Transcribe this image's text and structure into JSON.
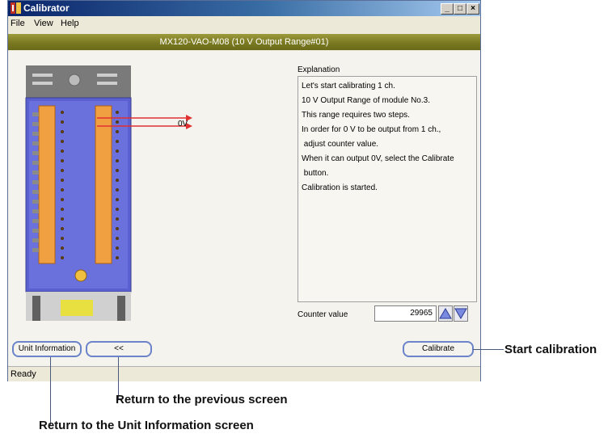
{
  "window": {
    "title": "Calibrator"
  },
  "menu": {
    "items": [
      "File",
      "View",
      "Help"
    ]
  },
  "header": {
    "title": "MX120-VAO-M08 (10 V Output Range#01)"
  },
  "diagram": {
    "output_label": "0V"
  },
  "explanation": {
    "label": "Explanation",
    "lines": [
      "Let's start calibrating 1 ch.",
      "10 V Output Range of module No.3.",
      "This range requires two steps.",
      "In order for 0 V to be output from 1 ch.,",
      " adjust counter value.",
      "When it can output 0V, select the Calibrate",
      " button.",
      "Calibration is started."
    ]
  },
  "counter": {
    "label": "Counter value",
    "value": "29965"
  },
  "buttons": {
    "unit_info": "Unit Information",
    "back": "<<",
    "calibrate": "Calibrate"
  },
  "status": {
    "text": "Ready"
  },
  "annotations": {
    "start_calibration": "Start calibration",
    "return_previous": "Return to the previous screen",
    "return_unit_info": "Return to the Unit Information screen"
  },
  "colors": {
    "titlebar": "#0a246a",
    "header_bar": "#7d7c24",
    "module_body": "#5a60d0",
    "terminal": "#f0a040",
    "arrow": "#e03030",
    "button_border": "#6b83c9"
  }
}
